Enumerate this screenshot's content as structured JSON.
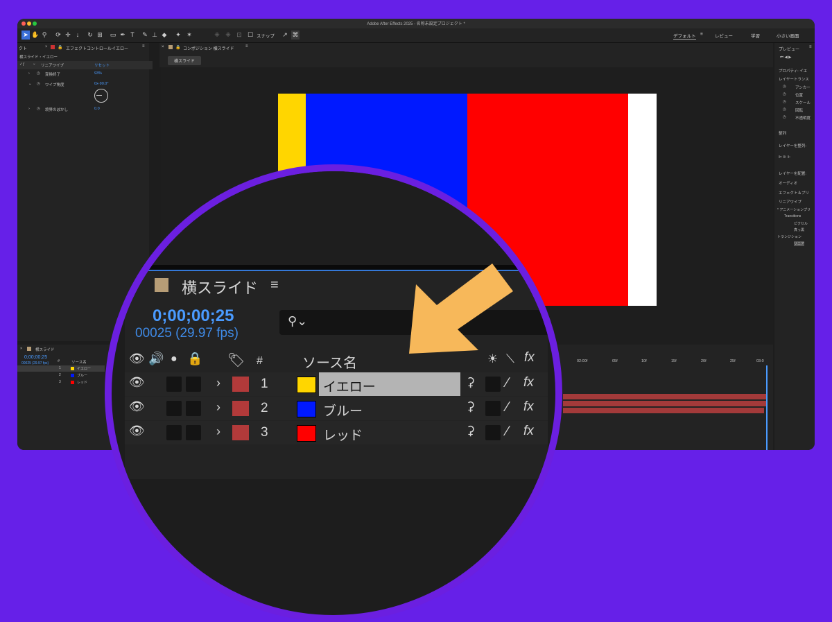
{
  "app": {
    "window_title": "Adobe After Effects 2025 - 名称未設定プロジェクト *"
  },
  "toolbar": {
    "snap_label": "スナップ",
    "workspaces": [
      "デフォルト",
      "レビュー",
      "学習",
      "小さい画面"
    ]
  },
  "effect_controls": {
    "tab_left": "クト",
    "tab_title": "エフェクトコントロールイエロー",
    "layer_path": "横スライド・イエロー",
    "effect_name": "リニアワイプ",
    "reset_label": "リセット",
    "props": [
      {
        "label": "変換終了",
        "value": "93%"
      },
      {
        "label": "ワイプ角度",
        "value": "0x-90.0°"
      },
      {
        "label": "境界のぼかし",
        "value": "0.0"
      }
    ]
  },
  "composition": {
    "tab_title": "コンポジション 横スライド",
    "comp_tab": "横スライド"
  },
  "right_panel": {
    "preview_title": "プレビュー",
    "properties_title": "プロパティ: イエ",
    "layer_transform": "レイヤートランス",
    "transform_props": [
      "アンカー",
      "位置",
      "スケール",
      "回転",
      "不透明度"
    ],
    "align_title": "整列",
    "align_layers_to": "レイヤーを整列:",
    "distribute_layers": "レイヤーを配置:",
    "audio": "オーディオ",
    "effects_title": "エフェクト＆プリ",
    "search_value": "リニアワイプ",
    "tree": [
      "* アニメーションプリ",
      "Transitions",
      "ピクセル",
      "真っ黒",
      "トランジション",
      "リニア"
    ]
  },
  "timeline": {
    "tab_title": "横スライド",
    "timecode": "0;00;00;25",
    "frame_info": "00025 (29.97 fps)",
    "column_source": "ソース名",
    "column_num": "#",
    "ruler_labels": [
      "02:00f",
      "05f",
      "10f",
      "15f",
      "20f",
      "25f",
      "03:0"
    ],
    "layers": [
      {
        "num": "1",
        "name": "イエロー",
        "color": "#ffd600",
        "selected": true
      },
      {
        "num": "2",
        "name": "ブルー",
        "color": "#0019ff",
        "selected": false
      },
      {
        "num": "3",
        "name": "レッド",
        "color": "#ff0000",
        "selected": false
      }
    ]
  },
  "zoom": {
    "comp_title": "横スライド",
    "timecode": "0;00;00;25",
    "frame_info": "00025 (29.97 fps)",
    "column_source": "ソース名",
    "column_num": "#",
    "fx_label": "fx"
  },
  "colors": {
    "background": "#6620e8",
    "ring": "#6b1fe0",
    "arrow": "#f7b85a",
    "accent_blue": "#4a9bff",
    "label_red": "#b23a3a"
  }
}
